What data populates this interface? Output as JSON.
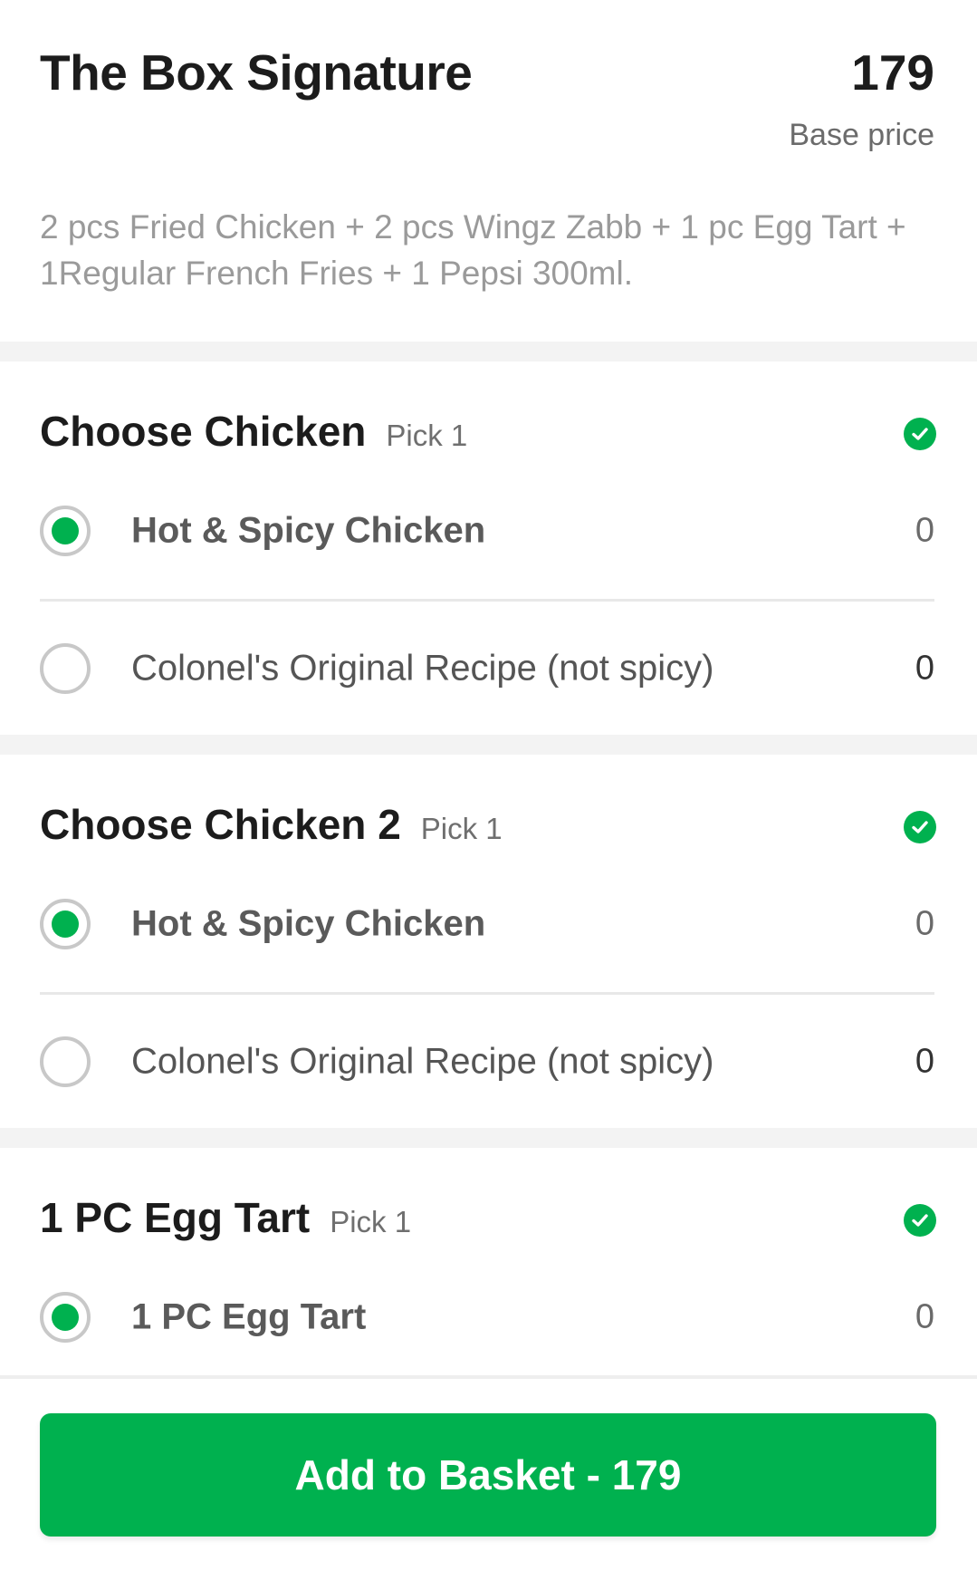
{
  "product": {
    "title": "The Box Signature",
    "price": "179",
    "base_price_label": "Base price",
    "description": "2 pcs Fried Chicken + 2 pcs Wingz Zabb + 1 pc Egg Tart + 1Regular French Fries + 1 Pepsi 300ml."
  },
  "sections": [
    {
      "title": "Choose Chicken",
      "pick": "Pick 1",
      "options": [
        {
          "label": "Hot & Spicy Chicken",
          "price": "0",
          "selected": true
        },
        {
          "label": "Colonel's Original Recipe (not spicy)",
          "price": "0",
          "selected": false
        }
      ]
    },
    {
      "title": "Choose Chicken 2",
      "pick": "Pick 1",
      "options": [
        {
          "label": "Hot & Spicy Chicken",
          "price": "0",
          "selected": true
        },
        {
          "label": "Colonel's Original Recipe (not spicy)",
          "price": "0",
          "selected": false
        }
      ]
    },
    {
      "title": "1 PC Egg Tart",
      "pick": "Pick 1",
      "options": [
        {
          "label": "1 PC Egg Tart",
          "price": "0",
          "selected": true
        }
      ]
    }
  ],
  "footer": {
    "add_button_label": "Add to Basket - 179"
  },
  "colors": {
    "accent": "#00b14f",
    "background_band": "#f3f3f3"
  }
}
